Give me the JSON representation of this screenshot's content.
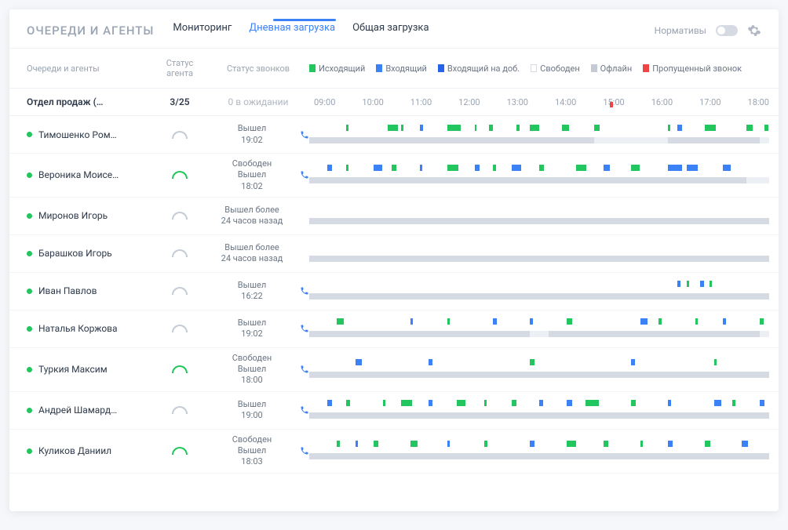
{
  "title": "ОЧЕРЕДИ И АГЕНТЫ",
  "tabs": [
    {
      "label": "Мониторинг",
      "active": false
    },
    {
      "label": "Дневная загрузка",
      "active": true
    },
    {
      "label": "Общая загрузка",
      "active": false
    }
  ],
  "normLabel": "Нормативы",
  "columns": {
    "queues": "Очереди и агенты",
    "agentStatus": "Статус агента",
    "callStatus": "Статус звонков"
  },
  "legend": [
    {
      "label": "Исходящий",
      "class": "green"
    },
    {
      "label": "Входящий",
      "class": "blue"
    },
    {
      "label": "Входящий на доб.",
      "class": "dblue"
    },
    {
      "label": "Свободен",
      "class": "free"
    },
    {
      "label": "Офлайн",
      "class": "grey"
    },
    {
      "label": "Пропущенный звонок",
      "class": "red"
    }
  ],
  "group": {
    "name": "Отдел продаж (…",
    "status": "3/25",
    "waiting": "0 в ожидании"
  },
  "timeTicks": [
    "09:00",
    "10:00",
    "11:00",
    "12:00",
    "13:00",
    "14:00",
    "15:00",
    "16:00",
    "17:00",
    "18:00"
  ],
  "nowPercent": 64,
  "agents": [
    {
      "name": "Тимошенко Ром…",
      "online": true,
      "arcUp": false,
      "hasPhone": true,
      "statusLines": [
        "Вышел",
        "19:02"
      ],
      "t1": [
        [
          "green",
          8,
          0.6
        ],
        [
          "green",
          17,
          2.2
        ],
        [
          "green",
          20,
          0.5
        ],
        [
          "blue",
          24,
          0.8
        ],
        [
          "green",
          30,
          3
        ],
        [
          "green",
          36,
          0.4
        ],
        [
          "green",
          39,
          1
        ],
        [
          "green",
          45,
          0.8
        ],
        [
          "green",
          48,
          2
        ],
        [
          "green",
          55,
          1.5
        ],
        [
          "green",
          62,
          1.2
        ],
        [
          "green",
          78,
          0.5
        ],
        [
          "blue",
          80,
          1
        ],
        [
          "green",
          86,
          2.4
        ],
        [
          "green",
          95,
          1.5
        ],
        [
          "green",
          99,
          0.8
        ]
      ],
      "t2": [
        [
          "grey",
          0,
          62
        ],
        [
          "grey",
          78,
          20
        ]
      ]
    },
    {
      "name": "Вероника Моисе…",
      "online": true,
      "arcUp": true,
      "hasPhone": true,
      "statusLines": [
        "Свободен",
        "Вышел",
        "18:02"
      ],
      "t1": [
        [
          "blue",
          4,
          1
        ],
        [
          "green",
          8,
          0.6
        ],
        [
          "blue",
          14,
          1.8
        ],
        [
          "green",
          18,
          1
        ],
        [
          "blue",
          24,
          0.6
        ],
        [
          "green",
          30,
          2.5
        ],
        [
          "blue",
          36,
          1
        ],
        [
          "green",
          40,
          0.6
        ],
        [
          "blue",
          44,
          2
        ],
        [
          "green",
          50,
          1
        ],
        [
          "green",
          58,
          2.2
        ],
        [
          "blue",
          64,
          1.4
        ],
        [
          "green",
          70,
          1.8
        ],
        [
          "blue",
          78,
          3
        ],
        [
          "blue",
          82,
          2.4
        ],
        [
          "blue",
          90,
          1.6
        ]
      ],
      "t2": [
        [
          "grey",
          0,
          95
        ]
      ]
    },
    {
      "name": "Миронов Игорь",
      "online": true,
      "arcUp": false,
      "hasPhone": false,
      "statusLines": [
        "Вышел более",
        "24 часов назад"
      ],
      "t1": [],
      "t2": [
        [
          "grey",
          0,
          100
        ]
      ]
    },
    {
      "name": "Барашков Игорь",
      "online": true,
      "arcUp": false,
      "hasPhone": false,
      "statusLines": [
        "Вышел более",
        "24 часов назад"
      ],
      "t1": [],
      "t2": [
        [
          "grey",
          0,
          100
        ]
      ]
    },
    {
      "name": "Иван Павлов",
      "online": true,
      "arcUp": false,
      "hasPhone": true,
      "statusLines": [
        "Вышел",
        "16:22"
      ],
      "t1": [
        [
          "blue",
          80,
          0.8
        ],
        [
          "green",
          82,
          0.6
        ],
        [
          "blue",
          85,
          0.8
        ],
        [
          "green",
          87,
          0.6
        ]
      ],
      "t2": [
        [
          "grey",
          0,
          100
        ]
      ]
    },
    {
      "name": "Наталья Коржова",
      "online": true,
      "arcUp": false,
      "hasPhone": true,
      "statusLines": [
        "Вышел",
        "19:02"
      ],
      "t1": [
        [
          "green",
          6,
          1.5
        ],
        [
          "blue",
          22,
          0.6
        ],
        [
          "green",
          30,
          0.5
        ],
        [
          "blue",
          40,
          0.8
        ],
        [
          "blue",
          48,
          0.6
        ],
        [
          "green",
          56,
          1.2
        ],
        [
          "blue",
          72,
          1.6
        ],
        [
          "green",
          76,
          0.6
        ],
        [
          "green",
          84,
          0.4
        ],
        [
          "blue",
          90,
          0.6
        ],
        [
          "green",
          98,
          0.8
        ]
      ],
      "t2": [
        [
          "grey",
          0,
          48
        ],
        [
          "grey",
          52,
          46
        ]
      ]
    },
    {
      "name": "Туркия Максим",
      "online": true,
      "arcUp": true,
      "hasPhone": true,
      "statusLines": [
        "Свободен",
        "Вышел",
        "18:00"
      ],
      "t1": [
        [
          "blue",
          10,
          1.4
        ],
        [
          "blue",
          26,
          0.8
        ],
        [
          "green",
          48,
          1
        ],
        [
          "blue",
          70,
          0.8
        ],
        [
          "green",
          88,
          0.6
        ]
      ],
      "t2": [
        [
          "grey",
          0,
          100
        ]
      ]
    },
    {
      "name": "Андрей Шамард…",
      "online": true,
      "arcUp": false,
      "hasPhone": true,
      "statusLines": [
        "Вышел",
        "19:00"
      ],
      "t1": [
        [
          "blue",
          4,
          1
        ],
        [
          "green",
          8,
          0.8
        ],
        [
          "green",
          16,
          0.6
        ],
        [
          "green",
          20,
          2.4
        ],
        [
          "blue",
          26,
          0.8
        ],
        [
          "green",
          32,
          2
        ],
        [
          "green",
          38,
          0.6
        ],
        [
          "green",
          44,
          1
        ],
        [
          "blue",
          50,
          0.8
        ],
        [
          "blue",
          56,
          1.2
        ],
        [
          "green",
          60,
          3
        ],
        [
          "green",
          70,
          1
        ],
        [
          "blue",
          78,
          0.6
        ],
        [
          "blue",
          88,
          1.6
        ],
        [
          "green",
          92,
          0.6
        ],
        [
          "blue",
          98,
          1
        ]
      ],
      "t2": [
        [
          "grey",
          0,
          100
        ]
      ]
    },
    {
      "name": "Куликов Даниил",
      "online": true,
      "arcUp": true,
      "hasPhone": true,
      "statusLines": [
        "Свободен",
        "Вышел",
        "18:03"
      ],
      "t1": [
        [
          "green",
          6,
          0.6
        ],
        [
          "blue",
          10,
          0.6
        ],
        [
          "green",
          14,
          1
        ],
        [
          "green",
          22,
          1.6
        ],
        [
          "blue",
          30,
          0.6
        ],
        [
          "green",
          38,
          0.8
        ],
        [
          "blue",
          48,
          1
        ],
        [
          "green",
          56,
          2
        ],
        [
          "green",
          64,
          1
        ],
        [
          "green",
          72,
          0.6
        ],
        [
          "blue",
          78,
          1
        ],
        [
          "green",
          86,
          1.2
        ],
        [
          "blue",
          94,
          1.4
        ]
      ],
      "t2": [
        [
          "grey",
          0,
          100
        ]
      ]
    }
  ]
}
